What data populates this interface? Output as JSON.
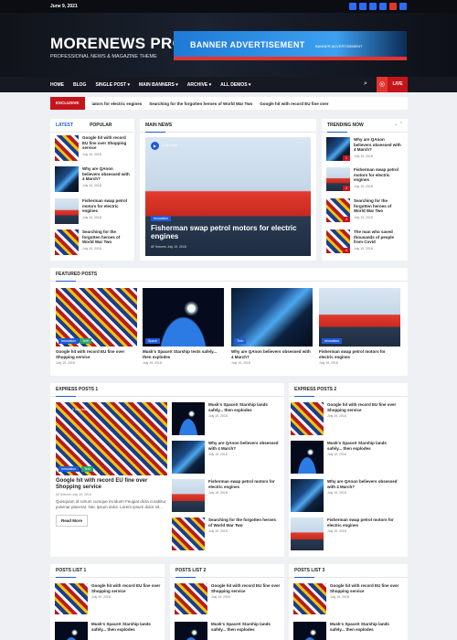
{
  "topbar": {
    "date": "June 9, 2021"
  },
  "masthead": {
    "logo": "MORENEWS PRO",
    "tagline": "PROFESSIONAL NEWS & MAGAZINE THEME",
    "banner_title": "BANNER ADVERTISEMENT",
    "banner_sub": "BANNER ADVERTISEMENT"
  },
  "nav": {
    "items": [
      "HOME",
      "BLOG",
      "SINGLE POST ▾",
      "MAIN BANNERS ▾",
      "ARCHIVE ▾",
      "ALL DEMOS ▾"
    ],
    "live": "LIVE"
  },
  "ticker": {
    "label": "EXCLUSIVE",
    "items": [
      "iators for electric engines",
      "Searching for the forgotten heroes of World War Two",
      "Google hit with record EU fine over"
    ]
  },
  "latest": {
    "tab_latest": "LATEST",
    "tab_popular": "POPULAR",
    "items": [
      {
        "title": "Google hit with record EU fine over Shopping service",
        "date": "July 19, 2018"
      },
      {
        "title": "Why are QAnon believers obsessed with 4 March?",
        "date": "July 19, 2018"
      },
      {
        "title": "Fisherman swap petrol motors for electric engines",
        "date": "July 19, 2018"
      },
      {
        "title": "Searching for the forgotten heroes of World War Two",
        "date": "July 19, 2018"
      }
    ]
  },
  "main_news": {
    "heading": "MAIN NEWS",
    "read_time": "2 min read",
    "category": "Innovation",
    "title": "Fisherman swap petrol motors for electric engines",
    "author": "AF themes",
    "date": "July 19, 2018"
  },
  "trending": {
    "heading": "TRENDING NOW",
    "items": [
      {
        "num": "1",
        "title": "Why are QAnon believers obsessed with 4 March?",
        "date": "July 19, 2018"
      },
      {
        "num": "2",
        "title": "Fisherman swap petrol motors for electric engines",
        "date": "July 19, 2018"
      },
      {
        "num": "3",
        "title": "Searching for the forgotten heroes of World War Two",
        "date": "July 19, 2018"
      },
      {
        "num": "4",
        "title": "The man who saved thousands of people from Covid",
        "date": "July 19, 2018"
      }
    ]
  },
  "featured": {
    "heading": "FEATURED POSTS",
    "items": [
      {
        "tag": "Innovation",
        "tag2": "Tech",
        "title": "Google hit with record EU fine over Shopping service",
        "date": "July 19, 2018"
      },
      {
        "tag": "Space",
        "title": "Musk's SpaceX Starship tests safely... then explodes",
        "date": "July 19, 2018"
      },
      {
        "tag": "Tech",
        "title": "Why are QAnon believers obsessed with 4 March?",
        "date": "July 19, 2018"
      },
      {
        "tag": "Innovation",
        "title": "Fisherman swap petrol motors for electric engines",
        "date": "July 19, 2018"
      }
    ]
  },
  "express1": {
    "heading": "EXPRESS POSTS 1",
    "main": {
      "read": "2 min read",
      "tag": "Innovation",
      "tag2": "Tech",
      "title": "Google hit with record EU fine over Shopping service",
      "author": "AF themes",
      "date": "July 19, 2018",
      "excerpt": "Quisquam id rutrum cumque incidunt! Feugiat dicta curabitur pulvinar placerat. Nec ipsum dolor. Lorem ipsum dolor sit...",
      "readmore": "Read More"
    },
    "items": [
      {
        "title": "Musk's SpaceX Starship lands safely... then explodes",
        "date": "July 19, 2018"
      },
      {
        "title": "Why are QAnon believers obsessed with 4 March?",
        "date": "July 19, 2018"
      },
      {
        "title": "Fisherman swap petrol motors for electric engines",
        "date": "July 19, 2018"
      },
      {
        "title": "Searching for the forgotten heroes of World War Two",
        "date": "July 19, 2018"
      }
    ]
  },
  "express2": {
    "heading": "EXPRESS POSTS 2",
    "items": [
      {
        "title": "Google hit with record EU fine over Shopping service",
        "date": "July 19, 2018"
      },
      {
        "title": "Musk's SpaceX Starship lands safely... then explodes",
        "date": "July 19, 2018"
      },
      {
        "title": "Why are QAnon believers obsessed with 4 March?",
        "date": "July 19, 2018"
      },
      {
        "title": "Fisherman swap petrol motors for electric engines",
        "date": "July 19, 2018"
      }
    ]
  },
  "lists": {
    "h1": "POSTS LIST 1",
    "h2": "POSTS LIST 2",
    "h3": "POSTS LIST 3",
    "a": {
      "title": "Google hit with record EU fine over Shopping service",
      "date": "July 19, 2018"
    },
    "b": {
      "title": "Musk's SpaceX Starship lands safely... then explodes"
    }
  },
  "colors": {
    "accent": "#1e5bd8",
    "live": "#c5151b",
    "nav": "#161922"
  }
}
